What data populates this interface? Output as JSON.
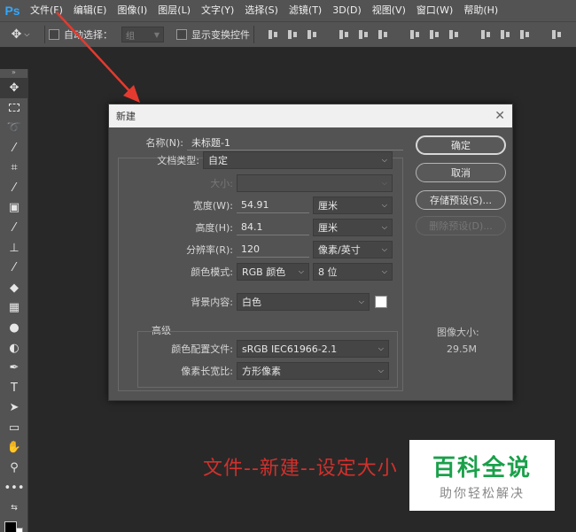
{
  "app": {
    "logo": "Ps"
  },
  "menu": [
    "文件(F)",
    "编辑(E)",
    "图像(I)",
    "图层(L)",
    "文字(Y)",
    "选择(S)",
    "滤镜(T)",
    "3D(D)",
    "视图(V)",
    "窗口(W)",
    "帮助(H)"
  ],
  "options": {
    "move_icon": "move-icon",
    "auto_select_label": "自动选择：",
    "auto_select_value": "组",
    "show_transform_label": "显示变换控件"
  },
  "tools": [
    "move-icon",
    "marquee-icon",
    "lasso-icon",
    "magic-wand-icon",
    "crop-icon",
    "eyedropper-icon",
    "healing-icon",
    "brush-icon",
    "stamp-icon",
    "history-brush-icon",
    "eraser-icon",
    "gradient-icon",
    "blur-icon",
    "dodge-icon",
    "pen-icon",
    "type-icon",
    "path-select-icon",
    "rectangle-icon",
    "hand-icon",
    "zoom-icon",
    "more-icon",
    "swap-colors-icon"
  ],
  "dialog": {
    "title": "新建",
    "close": "✕",
    "name_label": "名称(N):",
    "name_value": "未标题-1",
    "doc_type_label": "文档类型:",
    "doc_type_value": "自定",
    "size_label": "大小:",
    "width_label": "宽度(W):",
    "width_value": "54.91",
    "width_unit": "厘米",
    "height_label": "高度(H):",
    "height_value": "84.1",
    "height_unit": "厘米",
    "resolution_label": "分辨率(R):",
    "resolution_value": "120",
    "resolution_unit": "像素/英寸",
    "color_mode_label": "颜色模式:",
    "color_mode_value": "RGB 颜色",
    "bit_depth_value": "8 位",
    "background_label": "背景内容:",
    "background_value": "白色",
    "advanced_label": "高级",
    "color_profile_label": "颜色配置文件:",
    "color_profile_value": "sRGB IEC61966-2.1",
    "pixel_aspect_label": "像素长宽比:",
    "pixel_aspect_value": "方形像素",
    "ok_label": "确定",
    "cancel_label": "取消",
    "save_preset_label": "存储预设(S)...",
    "delete_preset_label": "删除预设(D)...",
    "image_size_label": "图像大小:",
    "image_size_value": "29.5M"
  },
  "caption": "文件--新建--设定大小",
  "watermark": {
    "title": "百科全说",
    "subtitle": "助你轻松解决"
  },
  "colors": {
    "annotation_red": "#d0312d",
    "watermark_green": "#1aa04a",
    "ui_gray": "#535353"
  }
}
